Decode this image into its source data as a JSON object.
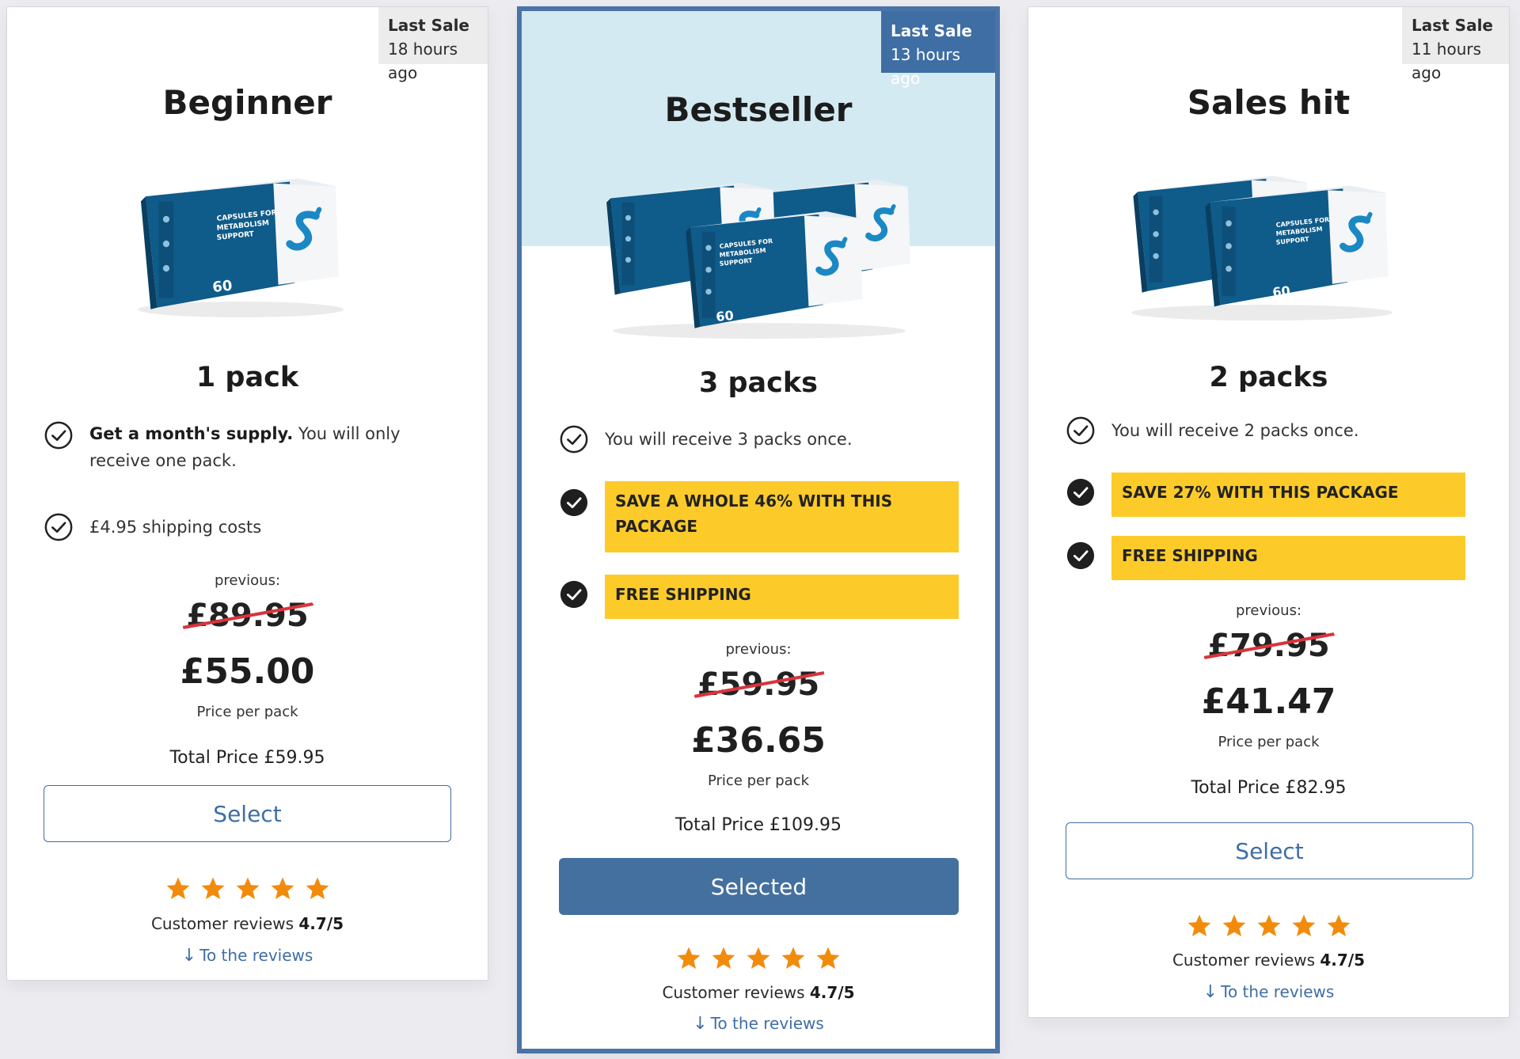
{
  "colors": {
    "accent_blue": "#44709f",
    "highlight_yellow": "#fccb2a",
    "star_orange": "#f28b0c",
    "strike_red": "#d9343b",
    "bestseller_bg": "#d4eaf2"
  },
  "box_labels": {
    "line1": "CAPSULES FOR",
    "line2": "METABOLISM",
    "line3": "SUPPORT",
    "count": "60"
  },
  "cards": [
    {
      "badge_title": "Last Sale",
      "badge_time": "18 hours ago",
      "title": "Beginner",
      "packs": "1 pack",
      "feature1_bold": "Get a month's supply.",
      "feature1_rest": " You will only receive one pack.",
      "feature2": "£4.95 shipping costs",
      "previous_label": "previous:",
      "old_price": "£89.95",
      "price": "£55.00",
      "price_per": "Price per pack",
      "total": "Total Price £59.95",
      "button": "Select",
      "rating": 5,
      "reviews_label": "Customer reviews",
      "reviews_score": "4.7/5",
      "reviews_link": "To the reviews"
    },
    {
      "badge_title": "Last Sale",
      "badge_time": "13 hours ago",
      "title": "Bestseller",
      "packs": "3 packs",
      "feature1": "You will receive 3 packs once.",
      "highlight1": "SAVE A WHOLE 46% WITH THIS PACKAGE",
      "highlight2": "FREE SHIPPING",
      "previous_label": "previous:",
      "old_price": "£59.95",
      "price": "£36.65",
      "price_per": "Price per pack",
      "total": "Total Price £109.95",
      "button": "Selected",
      "rating": 5,
      "reviews_label": "Customer reviews",
      "reviews_score": "4.7/5",
      "reviews_link": "To the reviews"
    },
    {
      "badge_title": "Last Sale",
      "badge_time": "11 hours ago",
      "title": "Sales hit",
      "packs": "2 packs",
      "feature1": "You will receive 2 packs once.",
      "highlight1": "SAVE 27% WITH THIS PACKAGE",
      "highlight2": "FREE SHIPPING",
      "previous_label": "previous:",
      "old_price": "£79.95",
      "price": "£41.47",
      "price_per": "Price per pack",
      "total": "Total Price £82.95",
      "button": "Select",
      "rating": 5,
      "reviews_label": "Customer reviews",
      "reviews_score": "4.7/5",
      "reviews_link": "To the reviews"
    }
  ]
}
